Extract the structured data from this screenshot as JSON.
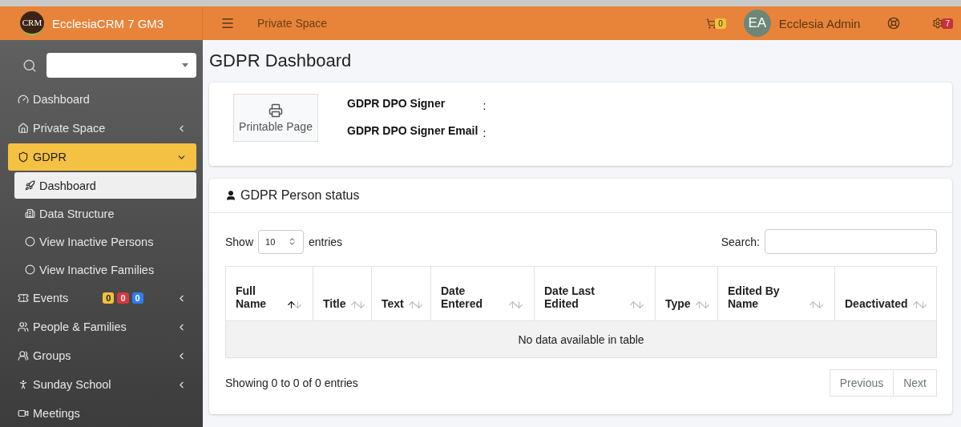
{
  "brand": {
    "logo": "CRM",
    "name": "EcclesiaCRM 7 GM3"
  },
  "topbar": {
    "link": "Private Space",
    "cart_count": "0",
    "avatar": "EA",
    "user": "Ecclesia Admin",
    "notification_count": "7"
  },
  "sidebar": {
    "items": [
      {
        "label": "Dashboard",
        "selected": false
      },
      {
        "label": "Private Space",
        "selected": false,
        "expanded": false
      },
      {
        "label": "GDPR",
        "selected": true,
        "expanded": true,
        "children": [
          {
            "label": "Dashboard",
            "selected": true
          },
          {
            "label": "Data Structure",
            "selected": false
          },
          {
            "label": "View Inactive Persons",
            "selected": false
          },
          {
            "label": "View Inactive Families",
            "selected": false
          }
        ]
      },
      {
        "label": "Events",
        "selected": false,
        "expanded": false,
        "badges": [
          {
            "text": "0",
            "color": "#f3c13a"
          },
          {
            "text": "0",
            "color": "#d9363e"
          },
          {
            "text": "0",
            "color": "#2f7ef0"
          }
        ]
      },
      {
        "label": "People & Families",
        "selected": false,
        "expanded": false
      },
      {
        "label": "Groups",
        "selected": false,
        "expanded": false
      },
      {
        "label": "Sunday School",
        "selected": false,
        "expanded": false
      },
      {
        "label": "Meetings",
        "selected": false
      }
    ]
  },
  "page_title": "GDPR Dashboard",
  "signer_card": {
    "button": "Printable Page",
    "fields": [
      {
        "label": "GDPR DPO Signer",
        "separator": ":"
      },
      {
        "label": "GDPR DPO Signer Email",
        "separator": ":"
      }
    ]
  },
  "status_card": {
    "title": "GDPR Person status",
    "show_label": "Show",
    "page_size": "10",
    "entries_label": "entries",
    "search_label": "Search:",
    "table": {
      "columns": [
        {
          "label": "Full Name",
          "sorted": true
        },
        {
          "label": "Title",
          "sorted": false
        },
        {
          "label": "Text",
          "sorted": false
        },
        {
          "label": "Date Entered",
          "sorted": false
        },
        {
          "label": "Date Last Edited",
          "sorted": false
        },
        {
          "label": "Type",
          "sorted": false
        },
        {
          "label": "Edited By Name",
          "sorted": false
        },
        {
          "label": "Deactivated",
          "sorted": false
        }
      ],
      "empty_message": "No data available in table"
    },
    "info": "Showing 0 to 0 of 0 entries",
    "pagination": [
      "Previous",
      "Next"
    ]
  }
}
